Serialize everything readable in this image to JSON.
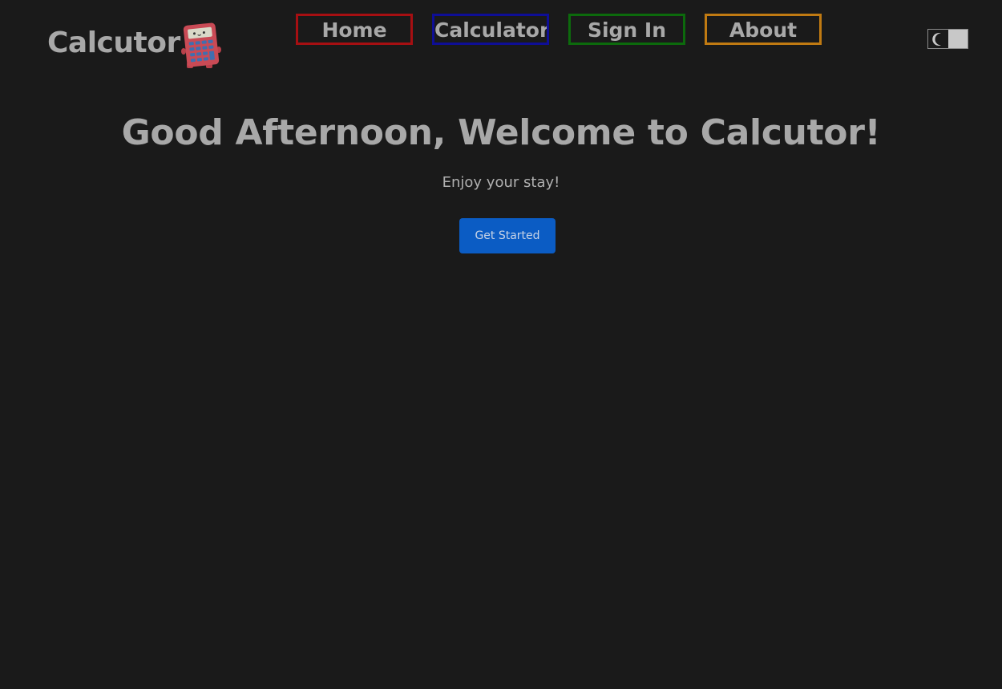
{
  "header": {
    "logo_text": "Calcutor",
    "logo_icon": "calculator-icon"
  },
  "nav": {
    "items": [
      {
        "label": "Home",
        "border_color": "#a60f12"
      },
      {
        "label": "Calculators",
        "border_color": "#0e0e96"
      },
      {
        "label": "Sign In",
        "border_color": "#0c6a0c"
      },
      {
        "label": "About",
        "border_color": "#c07a12"
      }
    ]
  },
  "theme_toggle": {
    "icon": "moon-icon",
    "state": "dark"
  },
  "hero": {
    "title": "Good Afternoon, Welcome to Calcutor!",
    "subtitle": "Enjoy your stay!",
    "cta_label": "Get Started"
  },
  "colors": {
    "background": "#1a1a1a",
    "text": "#a8a8a8",
    "button": "#0b5cc4"
  }
}
